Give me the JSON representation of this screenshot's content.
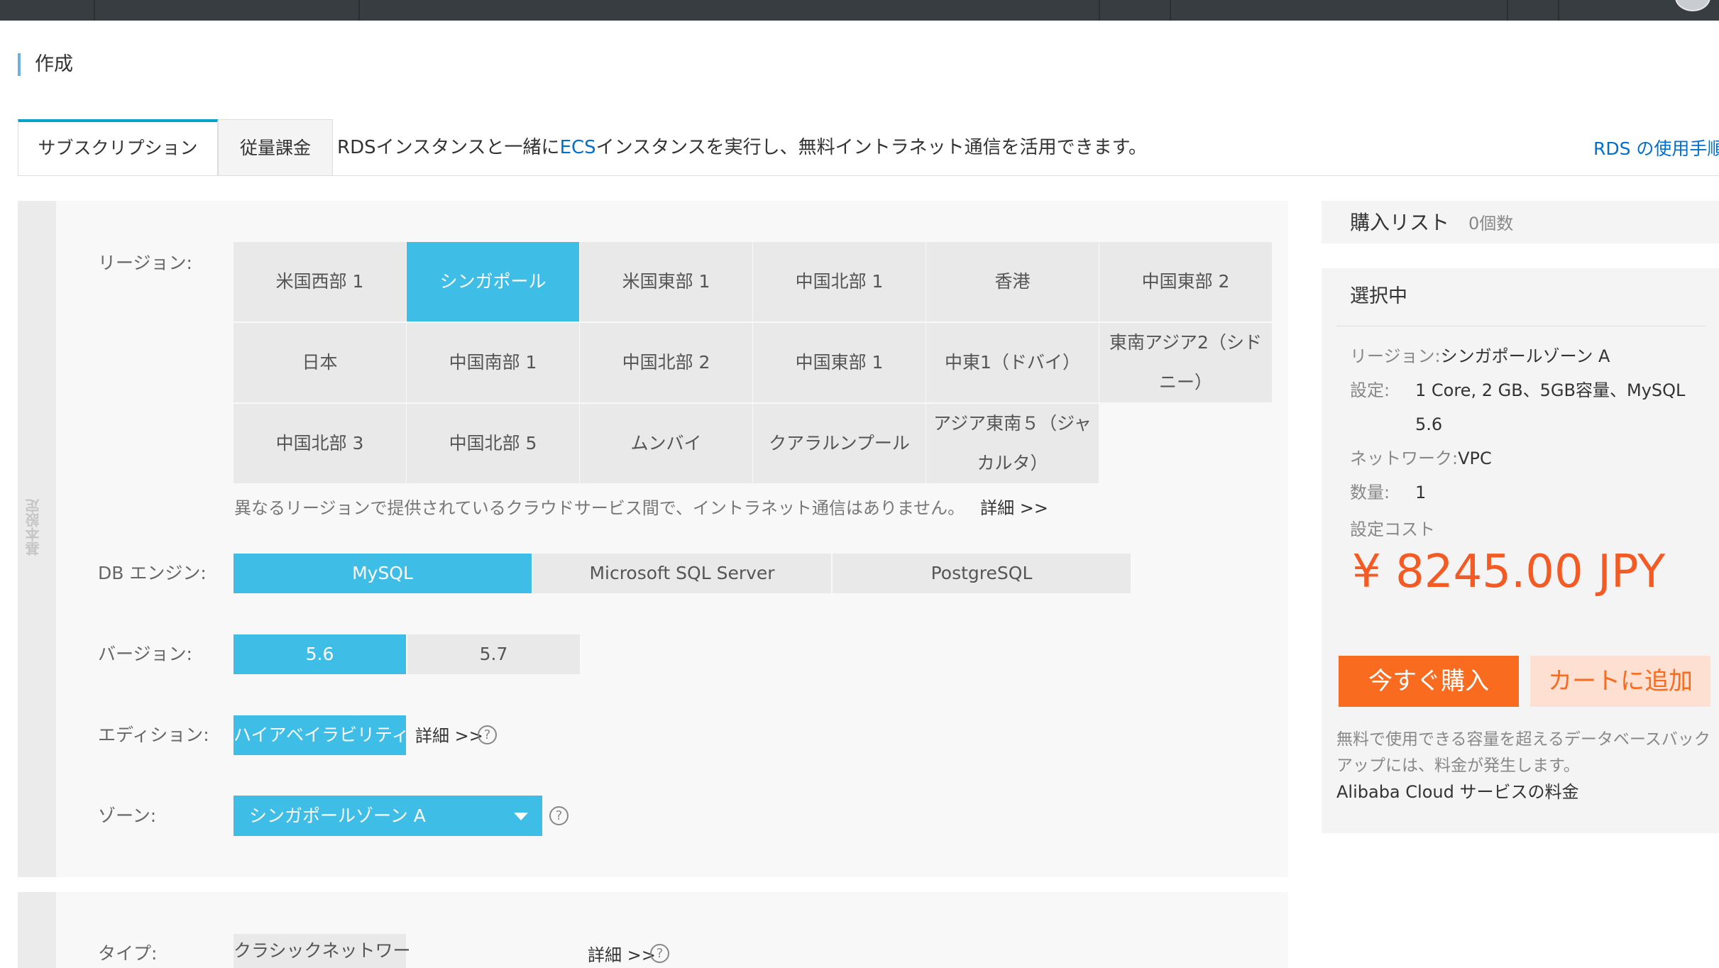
{
  "page_title": "作成",
  "tabs": {
    "subscription": "サブスクリプション",
    "payg": "従量課金"
  },
  "tab_note": {
    "pre": "RDSインスタンスと一緒に",
    "ecs": "ECS",
    "post": "インスタンスを実行し、無料イントラネット通信を活用できます。"
  },
  "guide_link": "RDS の使用手順",
  "section_basic": "基本設定",
  "region": {
    "label": "リージョン:",
    "options": [
      "米国西部 1",
      "シンガポール",
      "米国東部 1",
      "中国北部 1",
      "香港",
      "中国東部 2",
      "日本",
      "中国南部 1",
      "中国北部 2",
      "中国東部 1",
      "中東1（ドバイ）",
      "東南アジア2（シドニー）",
      "中国北部 3",
      "中国北部 5",
      "ムンバイ",
      "クアラルンプール",
      "アジア東南５（ジャカルタ）"
    ],
    "selected": "シンガポール",
    "hint": "異なるリージョンで提供されているクラウドサービス間で、イントラネット通信はありません。",
    "hint_more": "詳細 >>"
  },
  "engine": {
    "label": "DB エンジン:",
    "options": [
      "MySQL",
      "Microsoft SQL Server",
      "PostgreSQL"
    ],
    "selected": "MySQL"
  },
  "version": {
    "label": "バージョン:",
    "options": [
      "5.6",
      "5.7"
    ],
    "selected": "5.6"
  },
  "edition": {
    "label": "エディション:",
    "value": "ハイアベイラビリティ",
    "detail": "詳細 >>",
    "help": "?"
  },
  "zone": {
    "label": "ゾーン:",
    "value": "シンガポールゾーン A",
    "help": "?"
  },
  "network": {
    "type_label": "タイプ:",
    "type_value": "クラシックネットワー",
    "detail": "詳細 >>",
    "help": "?"
  },
  "cart": {
    "title": "購入リスト",
    "count": "0個数"
  },
  "summary": {
    "title": "選択中",
    "region_key": "リージョン:",
    "region_value": "シンガポールゾーン A",
    "config_key": "設定:",
    "config_value_1": "1 Core, 2 GB、5GB容量、MySQL",
    "config_value_2": "5.6",
    "network_key": "ネットワーク:",
    "network_value": "VPC",
    "qty_key": "数量:",
    "qty_value": "1",
    "cost_label": "設定コスト",
    "price": "¥  8245.00 JPY"
  },
  "buttons": {
    "buy": "今すぐ購入",
    "add_cart": "カートに追加"
  },
  "note": "無料で使用できる容量を超えるデータベースバックアップには、料金が発生します。",
  "fee_link": "Alibaba Cloud サービスの料金",
  "colors": {
    "accent": "#3ebde6",
    "price": "#f35a24",
    "buy": "#f96b1e",
    "link": "#0070cc"
  }
}
